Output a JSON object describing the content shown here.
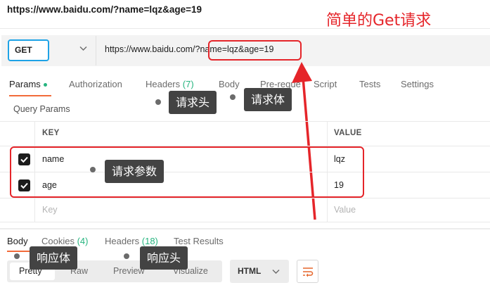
{
  "request_url_title": "https://www.baidu.com/?name=lqz&age=19",
  "annotation_title": "简单的Get请求",
  "url_bar": {
    "method": "GET",
    "url_base": "https://www.baidu.com/",
    "url_query": "?name=lqz&age=19"
  },
  "request_tabs": [
    {
      "label": "Params"
    },
    {
      "label": "Authorization"
    },
    {
      "label": "Headers",
      "count": "(7)"
    },
    {
      "label": "Body"
    },
    {
      "label": "Pre-reque"
    },
    {
      "label": "Script"
    },
    {
      "label": "Tests"
    },
    {
      "label": "Settings"
    }
  ],
  "query_params": {
    "section_label": "Query Params",
    "header_key": "KEY",
    "header_value": "VALUE",
    "rows": [
      {
        "key": "name",
        "value": "lqz",
        "checked": true
      },
      {
        "key": "age",
        "value": "19",
        "checked": true
      }
    ],
    "placeholder_key": "Key",
    "placeholder_value": "Value"
  },
  "annotations": {
    "request_headers": "请求头",
    "request_body": "请求体",
    "request_params": "请求参数",
    "response_body": "响应体",
    "response_headers": "响应头"
  },
  "response_tabs": [
    {
      "label": "Body"
    },
    {
      "label": "Cookies",
      "count": "(4)"
    },
    {
      "label": "Headers",
      "count": "(18)"
    },
    {
      "label": "Test Results"
    }
  ],
  "response_view": {
    "modes": [
      "Pretty",
      "Raw",
      "Preview",
      "Visualize"
    ],
    "format": "HTML"
  },
  "colors": {
    "annotation_red": "#e5252a",
    "accent_orange": "#f26b3a",
    "count_green": "#26b47f",
    "method_border_blue": "#1ea3e6",
    "tooltip_bg": "#434343"
  },
  "icons": [
    "chevron-down-icon",
    "check-icon",
    "wrap-lines-icon",
    "red-arrow-icon"
  ]
}
